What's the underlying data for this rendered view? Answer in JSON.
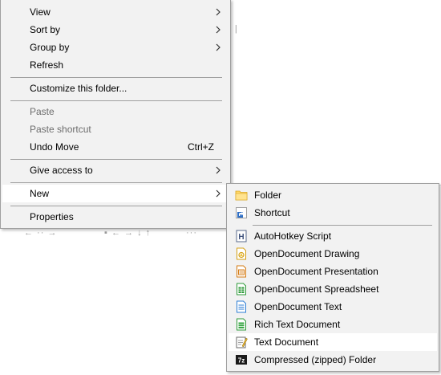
{
  "background": {
    "fragments": [
      "| |",
      "← ·· →",
      "▪ ← → ↓ ↑",
      "···"
    ]
  },
  "context_menu": {
    "items": [
      {
        "label": "View",
        "has_submenu": true
      },
      {
        "label": "Sort by",
        "has_submenu": true
      },
      {
        "label": "Group by",
        "has_submenu": true
      },
      {
        "label": "Refresh"
      },
      {
        "label": "Customize this folder..."
      },
      {
        "label": "Paste",
        "disabled": true
      },
      {
        "label": "Paste shortcut",
        "disabled": true
      },
      {
        "label": "Undo Move",
        "accelerator": "Ctrl+Z"
      },
      {
        "label": "Give access to",
        "has_submenu": true
      },
      {
        "label": "New",
        "has_submenu": true,
        "highlighted": true
      },
      {
        "label": "Properties"
      }
    ]
  },
  "new_submenu": {
    "items": [
      {
        "label": "Folder",
        "icon": "folder-icon"
      },
      {
        "label": "Shortcut",
        "icon": "shortcut-icon"
      },
      {
        "label": "AutoHotkey Script",
        "icon": "autohotkey-icon"
      },
      {
        "label": "OpenDocument Drawing",
        "icon": "odg-icon"
      },
      {
        "label": "OpenDocument Presentation",
        "icon": "odp-icon"
      },
      {
        "label": "OpenDocument Spreadsheet",
        "icon": "ods-icon"
      },
      {
        "label": "OpenDocument Text",
        "icon": "odt-icon"
      },
      {
        "label": "Rich Text Document",
        "icon": "rtf-icon"
      },
      {
        "label": "Text Document",
        "icon": "text-document-icon",
        "highlighted": true
      },
      {
        "label": "Compressed (zipped) Folder",
        "icon": "zip-icon"
      }
    ]
  },
  "colors": {
    "menu_bg": "#f2f2f2",
    "highlight": "#ffffff",
    "separator": "#a0a0a0",
    "disabled_text": "#6d6d6d",
    "folder_yellow": "#ffd86b",
    "odf_green": "#2e9a3a",
    "odf_blue": "#2f7fd6",
    "odf_orange": "#d47a12"
  }
}
